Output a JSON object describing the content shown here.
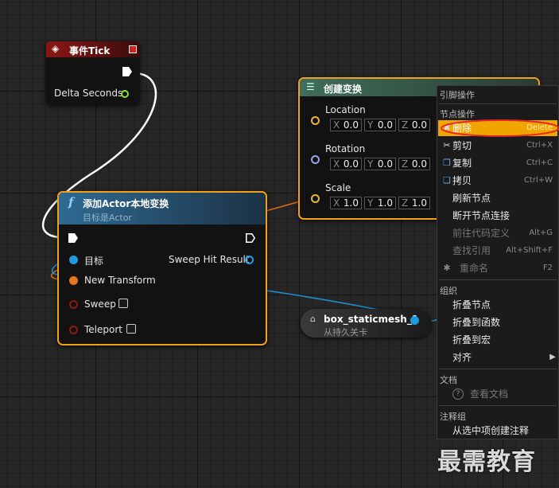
{
  "event_tick": {
    "title": "事件Tick",
    "delta_label": "Delta Seconds"
  },
  "make_transform": {
    "title": "创建变换",
    "location": {
      "label": "Location",
      "x": "0.0",
      "y": "0.0",
      "z": "0.0"
    },
    "rotation": {
      "label": "Rotation",
      "x": "0.0",
      "y": "0.0",
      "z": "0.0"
    },
    "scale": {
      "label": "Scale",
      "x": "1.0",
      "y": "1.0",
      "z": "1.0"
    },
    "axis": {
      "x": "X",
      "y": "Y",
      "z": "Z"
    }
  },
  "add_transform": {
    "title": "添加Actor本地变换",
    "subtitle": "目标是Actor",
    "target_label": "目标",
    "sweep_hit_label": "Sweep Hit Result",
    "new_transform_label": "New Transform",
    "sweep_label": "Sweep",
    "teleport_label": "Teleport"
  },
  "mesh_ref": {
    "title": "box_staticmesh_1",
    "subtitle": "从持久关卡"
  },
  "context_menu": {
    "sec_ref_ops": "引脚操作",
    "sec_node_ops": "节点操作",
    "items_node": [
      {
        "label": "删除",
        "shortcut": "Delete",
        "icon": "delete-icon"
      },
      {
        "label": "剪切",
        "shortcut": "Ctrl+X",
        "icon": "scissors-icon"
      },
      {
        "label": "复制",
        "shortcut": "Ctrl+C",
        "icon": "copy-icon"
      },
      {
        "label": "拷贝",
        "shortcut": "Ctrl+W",
        "icon": "duplicate-icon"
      },
      {
        "label": "刷新节点",
        "shortcut": ""
      },
      {
        "label": "断开节点连接",
        "shortcut": ""
      },
      {
        "label": "前往代码定义",
        "shortcut": "Alt+G"
      },
      {
        "label": "查找引用",
        "shortcut": "Alt+Shift+F"
      },
      {
        "label": "重命名",
        "shortcut": "F2",
        "icon": "rename-icon"
      }
    ],
    "sec_org": "组织",
    "items_org": [
      {
        "label": "折叠节点"
      },
      {
        "label": "折叠到函数"
      },
      {
        "label": "折叠到宏"
      },
      {
        "label": "对齐",
        "arrow": "▶"
      }
    ],
    "sec_doc": "文档",
    "doc_item": "查看文档",
    "sec_comment": "注释组",
    "comment_item": "从选中项创建注释"
  },
  "watermark": "最需教育",
  "colors": {
    "selection": "#f0a11c",
    "highlight": "#f0a500",
    "event_header": "#7a1414",
    "function_header": "#2a5775",
    "struct_header": "#2f4a3c"
  }
}
